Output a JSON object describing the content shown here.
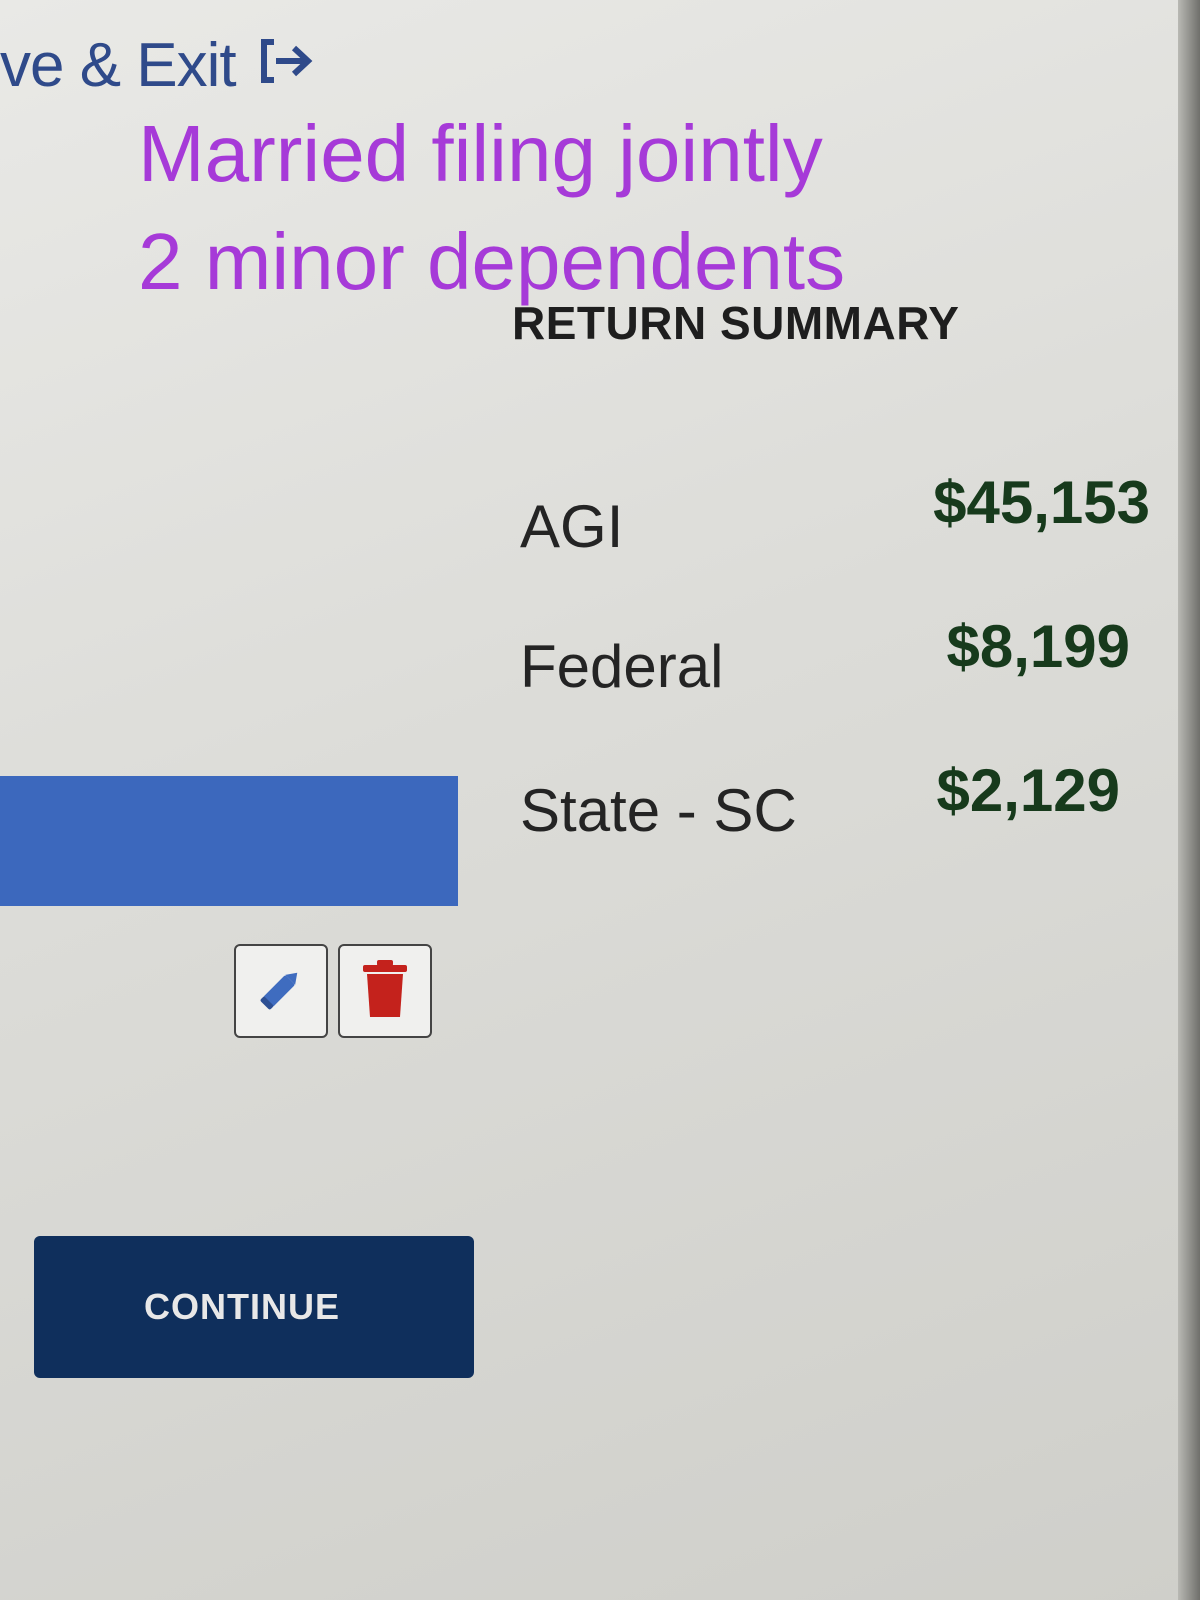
{
  "header": {
    "save_exit_label": "ve & Exit",
    "exit_icon": "exit-arrow-icon"
  },
  "annotation": {
    "line1": "Married filing jointly",
    "line2": "2 minor dependents",
    "color": "#a63ad8"
  },
  "summary": {
    "title": "RETURN SUMMARY",
    "rows": [
      {
        "label": "AGI",
        "value": "$45,153"
      },
      {
        "label": "Federal",
        "value": "$8,199"
      },
      {
        "label": "State - SC",
        "value": "$2,129"
      }
    ]
  },
  "actions": {
    "edit_icon": "pencil-icon",
    "delete_icon": "trash-icon",
    "continue_label": "CONTINUE"
  },
  "colors": {
    "accent_blue": "#3c68bd",
    "button_navy": "#0f2f5c",
    "value_green": "#173a1c",
    "delete_red": "#c4221c"
  }
}
